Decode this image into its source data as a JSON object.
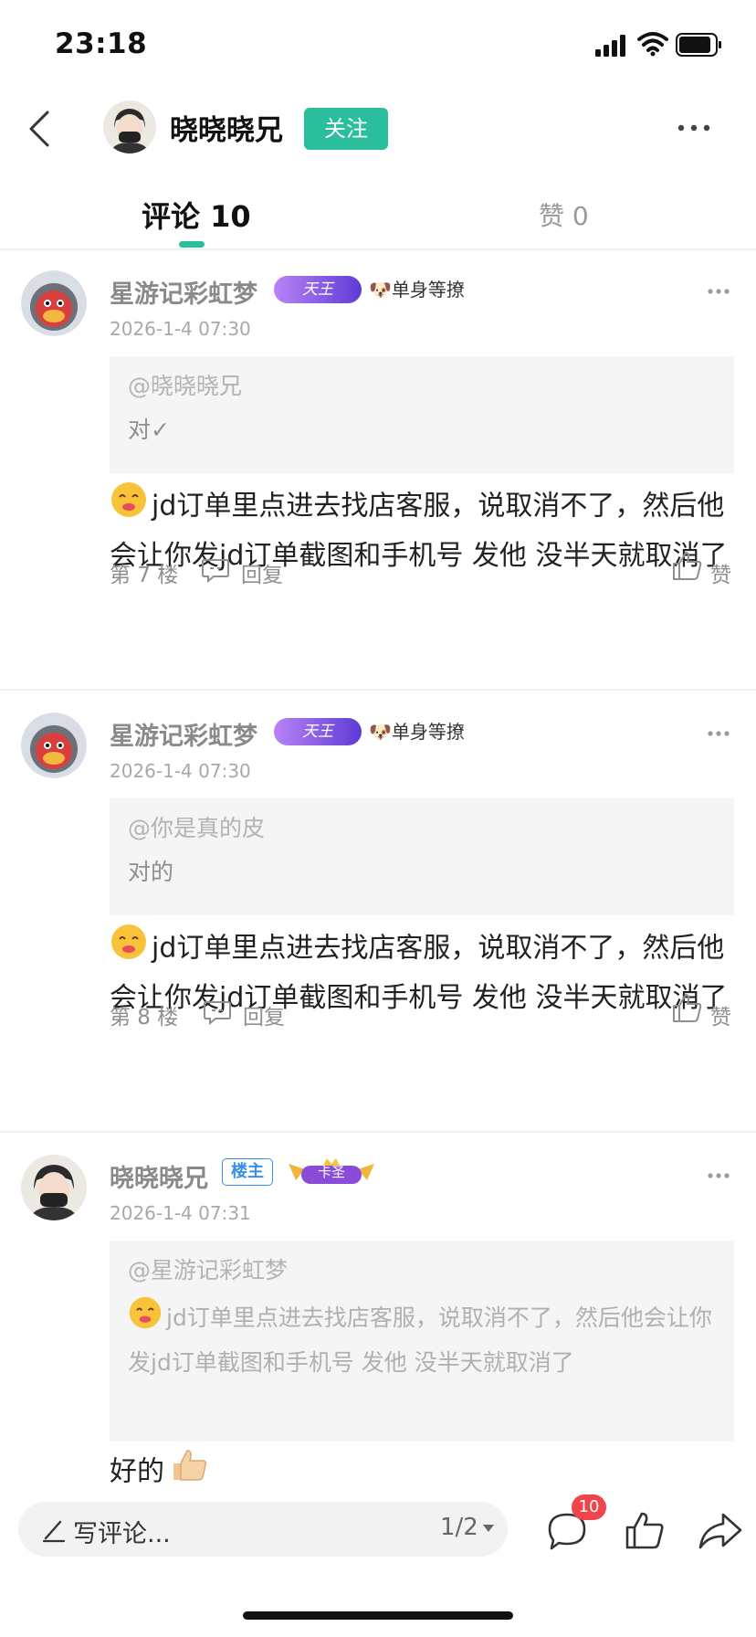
{
  "status_bar": {
    "time": "23:18"
  },
  "header": {
    "author_name": "晓晓晓兄",
    "follow_label": "关注"
  },
  "tabs": {
    "comments": "评论 10",
    "likes": "赞 0"
  },
  "comments": [
    {
      "user": "星游记彩虹梦",
      "badge": "天王",
      "doge_badge": "单身等撩",
      "date": "2026-1-4 07:30",
      "quote_user": "@晓晓晓兄",
      "quote_text": "对✓",
      "text": "jd订单里点进去找店客服，说取消不了，然后他会让你发jd订单截图和手机号 发他 没半天就取消了",
      "floor": "第 7 楼",
      "reply_label": "回复",
      "like_label": "赞"
    },
    {
      "user": "星游记彩虹梦",
      "badge": "天王",
      "doge_badge": "单身等撩",
      "date": "2026-1-4 07:30",
      "quote_user": "@你是真的皮",
      "quote_text": "对的",
      "text": "jd订单里点进去找店客服，说取消不了，然后他会让你发jd订单截图和手机号 发他 没半天就取消了",
      "floor": "第 8 楼",
      "reply_label": "回复",
      "like_label": "赞"
    },
    {
      "user": "晓晓晓兄",
      "owner_badge": "楼主",
      "sage_badge": "卡圣",
      "date": "2026-1-4 07:31",
      "quote_user": "@星游记彩虹梦",
      "quote_text": "jd订单里点进去找店客服，说取消不了，然后他会让你发jd订单截图和手机号 发他 没半天就取消了",
      "text": "好的"
    }
  ],
  "bottom_bar": {
    "placeholder": "写评论...",
    "page": "1/2",
    "comment_count": "10"
  },
  "colors": {
    "accent": "#2bbe9c",
    "badge_red": "#f0454a",
    "owner_blue": "#3a8fe4"
  },
  "icons": [
    "back-icon",
    "more-icon",
    "reply-icon",
    "thumbs-up-icon",
    "pen-icon",
    "comment-icon",
    "share-icon"
  ]
}
